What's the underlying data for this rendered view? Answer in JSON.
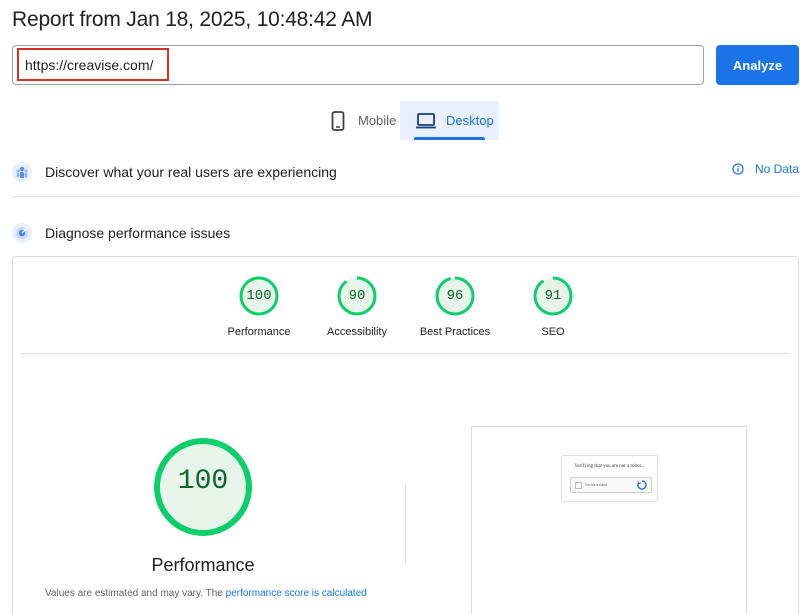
{
  "header": {
    "title": "Report from Jan 18, 2025, 10:48:42 AM"
  },
  "url_input": {
    "value": "https://creavise.com/"
  },
  "analyze_button": {
    "label": "Analyze"
  },
  "tabs": [
    {
      "label": "Mobile",
      "icon": "phone-icon",
      "selected": false
    },
    {
      "label": "Desktop",
      "icon": "laptop-icon",
      "selected": true
    }
  ],
  "field_data": {
    "title": "Discover what your real users are experiencing",
    "status": "No Data",
    "icon": "users-icon",
    "status_icon": "info-icon"
  },
  "lab_data": {
    "title": "Diagnose performance issues",
    "icon": "lighthouse-icon"
  },
  "scores": [
    {
      "value": "100",
      "label": "Performance"
    },
    {
      "value": "90",
      "label": "Accessibility"
    },
    {
      "value": "96",
      "label": "Best Practices"
    },
    {
      "value": "91",
      "label": "SEO"
    }
  ],
  "main_score": {
    "value": "100",
    "label": "Performance",
    "note_prefix": "Values are estimated and may vary. The ",
    "note_link": "performance score is calculated"
  },
  "preview": {
    "captcha_title": "Verifying that you are not a robot...",
    "captcha_label": "I'm not a robot"
  },
  "colors": {
    "accent": "#1a73e8",
    "pass_green": "#0cce6b",
    "pass_fill": "#e6f4ea",
    "pass_text": "#0d652d",
    "highlight_red": "#d93025"
  }
}
